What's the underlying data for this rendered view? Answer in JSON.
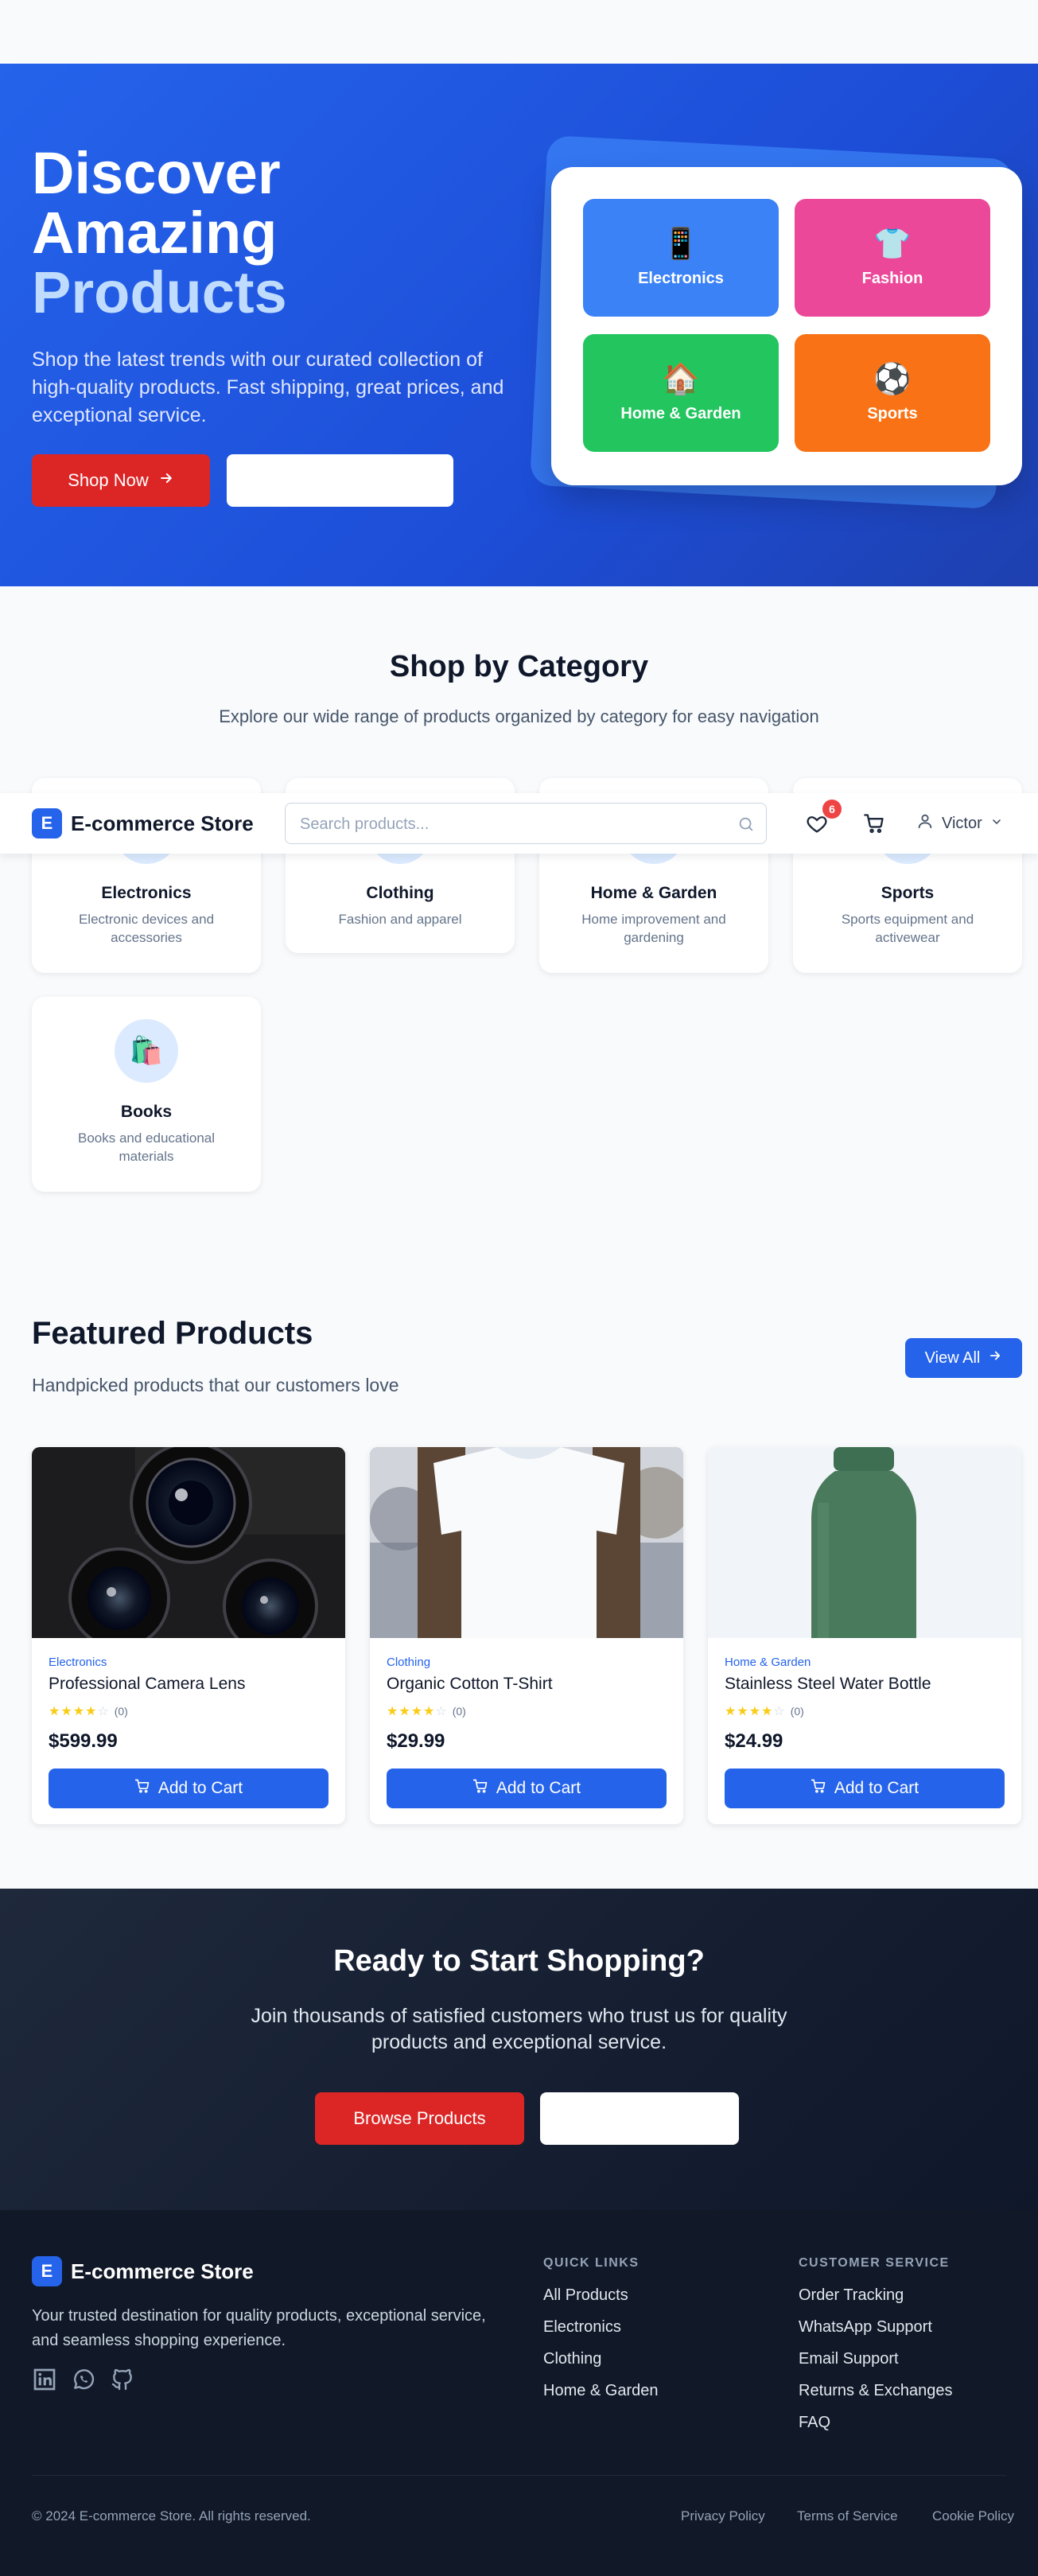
{
  "hero": {
    "title_line1": "Discover",
    "title_line2": "Amazing",
    "title_line3": "Products",
    "subtitle": "Shop the latest trends with our curated collection of high-quality products. Fast shipping, great prices, and exceptional service.",
    "primary_button": "Shop Now",
    "secondary_button": "",
    "tiles": [
      {
        "label": "Electronics",
        "icon": "mobile-phone-icon",
        "glyph": "📱",
        "color": "#3b82f6"
      },
      {
        "label": "Fashion",
        "icon": "t-shirt-icon",
        "glyph": "👕",
        "color": "#ec4899"
      },
      {
        "label": "Home & Garden",
        "icon": "house-icon",
        "glyph": "🏠",
        "color": "#22c55e"
      },
      {
        "label": "Sports",
        "icon": "soccer-ball-icon",
        "glyph": "⚽",
        "color": "#f97316"
      }
    ]
  },
  "categories": {
    "title": "Shop by Category",
    "subtitle": "Explore our wide range of products organized by category for easy navigation",
    "items": [
      {
        "name": "Electronics",
        "description": "Electronic devices and accessories"
      },
      {
        "name": "Clothing",
        "description": "Fashion and apparel"
      },
      {
        "name": "Home & Garden",
        "description": "Home improvement and gardening"
      },
      {
        "name": "Sports",
        "description": "Sports equipment and activewear"
      },
      {
        "name": "Books",
        "description": "Books and educational materials",
        "icon": "shopping-bag-icon",
        "glyph": "🛍️"
      }
    ]
  },
  "header": {
    "logo_letter": "E",
    "brand": "E-commerce Store",
    "search_placeholder": "Search products...",
    "wishlist_count": "6",
    "user_name": "Victor"
  },
  "featured": {
    "title": "Featured Products",
    "subtitle": "Handpicked products that our customers love",
    "view_all": "View All",
    "products": [
      {
        "category": "Electronics",
        "name": "Professional Camera Lens",
        "rating": 4,
        "reviews": "(0)",
        "price": "$599.99",
        "button": "Add to Cart"
      },
      {
        "category": "Clothing",
        "name": "Organic Cotton T-Shirt",
        "rating": 4,
        "reviews": "(0)",
        "price": "$29.99",
        "button": "Add to Cart"
      },
      {
        "category": "Home & Garden",
        "name": "Stainless Steel Water Bottle",
        "rating": 4,
        "reviews": "(0)",
        "price": "$24.99",
        "button": "Add to Cart"
      }
    ]
  },
  "cta": {
    "title": "Ready to Start Shopping?",
    "subtitle": "Join thousands of satisfied customers who trust us for quality products and exceptional service.",
    "primary_button": "Browse Products",
    "secondary_button": ""
  },
  "footer": {
    "logo_letter": "E",
    "brand": "E-commerce Store",
    "description": "Your trusted destination for quality products, exceptional service, and seamless shopping experience.",
    "quick_links_heading": "QUICK LINKS",
    "quick_links": [
      "All Products",
      "Electronics",
      "Clothing",
      "Home & Garden"
    ],
    "service_heading": "CUSTOMER SERVICE",
    "service_links": [
      "Order Tracking",
      "WhatsApp Support",
      "Email Support",
      "Returns & Exchanges",
      "FAQ"
    ],
    "copyright": "© 2024 E-commerce Store. All rights reserved.",
    "legal": [
      "Privacy Policy",
      "Terms of Service",
      "Cookie Policy"
    ]
  },
  "colors": {
    "primary": "#2563eb",
    "accent_red": "#dc2626",
    "dark": "#0f172a"
  }
}
